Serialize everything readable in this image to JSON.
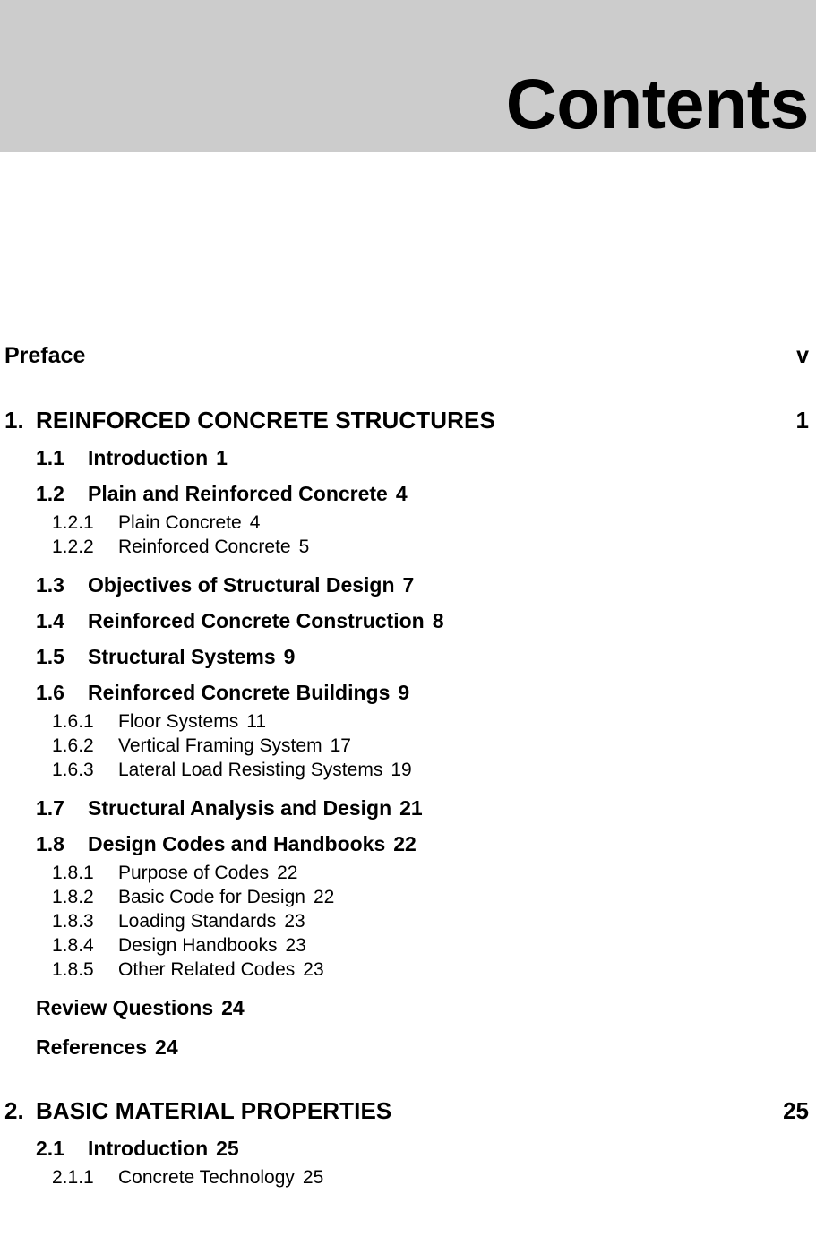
{
  "header": {
    "title": "Contents",
    "band_color": "#cccccc"
  },
  "toc": {
    "front_matter": [
      {
        "label": "Preface",
        "page": "v"
      }
    ],
    "entries": [
      {
        "level": "chapter",
        "number": "1.",
        "label": "REINFORCED CONCRETE STRUCTURES",
        "page": "1"
      },
      {
        "level": "2",
        "number": "1.1",
        "label": "Introduction",
        "page": "1"
      },
      {
        "level": "2",
        "number": "1.2",
        "label": "Plain and Reinforced Concrete",
        "page": "4"
      },
      {
        "level": "3",
        "number": "1.2.1",
        "label": "Plain Concrete",
        "page": "4"
      },
      {
        "level": "3",
        "number": "1.2.2",
        "label": "Reinforced Concrete",
        "page": "5"
      },
      {
        "level": "2",
        "number": "1.3",
        "label": "Objectives of Structural Design",
        "page": "7"
      },
      {
        "level": "2",
        "number": "1.4",
        "label": "Reinforced Concrete Construction",
        "page": "8"
      },
      {
        "level": "2",
        "number": "1.5",
        "label": "Structural Systems",
        "page": "9"
      },
      {
        "level": "2",
        "number": "1.6",
        "label": "Reinforced Concrete Buildings",
        "page": "9"
      },
      {
        "level": "3",
        "number": "1.6.1",
        "label": "Floor Systems",
        "page": "11"
      },
      {
        "level": "3",
        "number": "1.6.2",
        "label": "Vertical Framing System",
        "page": "17"
      },
      {
        "level": "3",
        "number": "1.6.3",
        "label": "Lateral Load Resisting Systems",
        "page": "19"
      },
      {
        "level": "2",
        "number": "1.7",
        "label": "Structural Analysis and Design",
        "page": "21"
      },
      {
        "level": "2",
        "number": "1.8",
        "label": "Design Codes and Handbooks",
        "page": "22"
      },
      {
        "level": "3",
        "number": "1.8.1",
        "label": "Purpose of Codes",
        "page": "22"
      },
      {
        "level": "3",
        "number": "1.8.2",
        "label": "Basic Code for Design",
        "page": "22"
      },
      {
        "level": "3",
        "number": "1.8.3",
        "label": "Loading Standards",
        "page": "23"
      },
      {
        "level": "3",
        "number": "1.8.4",
        "label": "Design Handbooks",
        "page": "23"
      },
      {
        "level": "3",
        "number": "1.8.5",
        "label": "Other Related Codes",
        "page": "23"
      },
      {
        "level": "2-nonum",
        "number": "",
        "label": "Review Questions",
        "page": "24"
      },
      {
        "level": "2-nonum",
        "number": "",
        "label": "References",
        "page": "24"
      },
      {
        "level": "chapter",
        "number": "2.",
        "label": "BASIC MATERIAL PROPERTIES",
        "page": "25"
      },
      {
        "level": "2",
        "number": "2.1",
        "label": "Introduction",
        "page": "25"
      },
      {
        "level": "3",
        "number": "2.1.1",
        "label": "Concrete Technology",
        "page": "25"
      }
    ]
  }
}
